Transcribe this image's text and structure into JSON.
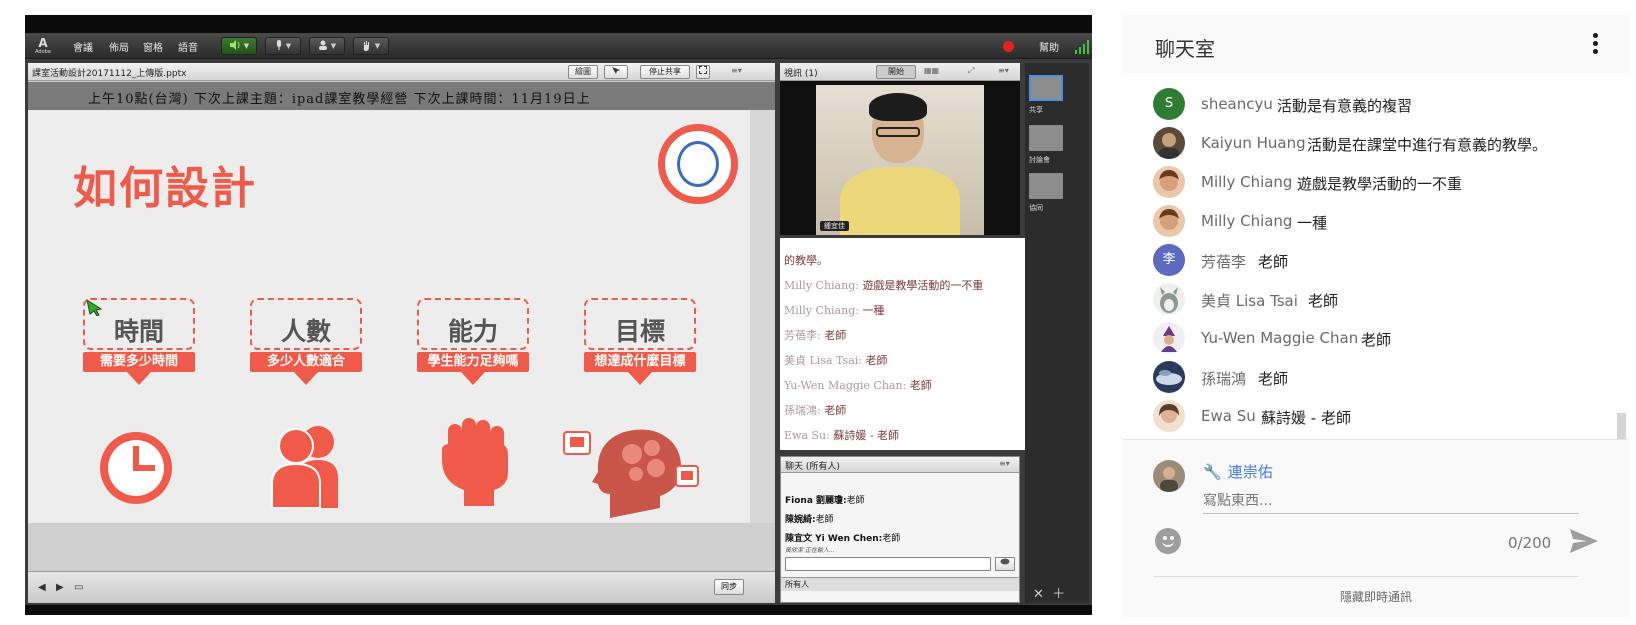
{
  "connect": {
    "logo": "A",
    "logo_sub": "Adobe",
    "menu": [
      "會議",
      "佈局",
      "窗格",
      "語音"
    ],
    "help": "幫助",
    "share_pod": {
      "title": "課室活動設計20171112_上傳版.pptx",
      "buttons": [
        "繪圖",
        "停止共享"
      ],
      "ticker": "上午10點(台灣)  下次上課主題：ipad課室教學經營    下次上課時間：11月19日上",
      "sync_button": "同步"
    },
    "slide": {
      "title": "如何設計",
      "cards": [
        {
          "title": "時間",
          "banner": "需要多少時間",
          "icon": "clock-icon"
        },
        {
          "title": "人數",
          "banner": "多少人數適合",
          "icon": "people-icon"
        },
        {
          "title": "能力",
          "banner": "學生能力足夠嗎",
          "icon": "fist-icon"
        },
        {
          "title": "目標",
          "banner": "想達成什麼目標",
          "icon": "brain-gears-icon"
        }
      ]
    },
    "camera_pod": {
      "title": "視訊 (1)",
      "buttons": [
        "開始"
      ],
      "name_tag": "鍾宜佳"
    },
    "overlay_chat": [
      {
        "name": "",
        "text": "的教學。"
      },
      {
        "name": "Milly Chiang: ",
        "text": "遊戲是教學活動的一不重"
      },
      {
        "name": "Milly Chiang: ",
        "text": "一種"
      },
      {
        "name": "芳蓓李: ",
        "text": "老師"
      },
      {
        "name": "美貞 Lisa Tsai: ",
        "text": "老師"
      },
      {
        "name": "Yu-Wen Maggie Chan: ",
        "text": "老師"
      },
      {
        "name": "孫瑞鴻: ",
        "text": "老師"
      },
      {
        "name": "Ewa Su: ",
        "text": "蘇詩媛 - 老師"
      }
    ],
    "chat_pod": {
      "title": "聊天 (所有人)",
      "lines": [
        {
          "name": "Fiona 劉麗瓊:",
          "text": "老師"
        },
        {
          "name": "陳婉綺:",
          "text": "老師"
        },
        {
          "name": "陳宜文 Yi Wen Chen:",
          "text": "老師"
        }
      ],
      "typing": "黃欣潔 正在輸入...",
      "footer": "所有人"
    },
    "layouts": [
      {
        "label": "共享"
      },
      {
        "label": "討論會"
      },
      {
        "label": "協同"
      }
    ]
  },
  "yt_chat": {
    "title": "聊天室",
    "messages": [
      {
        "author": "sheancyu",
        "text": "活動是有意義的複習",
        "avatar_letter": "S",
        "avatar_color": "#2e7d32"
      },
      {
        "author": "Kaiyun Huang",
        "text": "活動是在課堂中進行有意義的教學。",
        "avatar_letter": "",
        "avatar_color": "#5a4a3a"
      },
      {
        "author": "Milly Chiang",
        "text": "遊戲是教學活動的一不重",
        "avatar_letter": "",
        "avatar_color": "#c89070"
      },
      {
        "author": "Milly Chiang",
        "text": "一種",
        "avatar_letter": "",
        "avatar_color": "#c89070"
      },
      {
        "author": "芳蓓李",
        "text": "老師",
        "avatar_letter": "李",
        "avatar_color": "#5c6bc0"
      },
      {
        "author": "美貞 Lisa Tsai",
        "text": "老師",
        "avatar_letter": "",
        "avatar_color": "#9aa4a0"
      },
      {
        "author": "Yu-Wen Maggie Chan",
        "text": "老師",
        "avatar_letter": "",
        "avatar_color": "#7a4a8a"
      },
      {
        "author": "孫瑞鴻",
        "text": "老師",
        "avatar_letter": "",
        "avatar_color": "#3a4a6a"
      },
      {
        "author": "Ewa Su",
        "text": "蘇詩媛 - 老師",
        "avatar_letter": "",
        "avatar_color": "#b08a6a"
      }
    ],
    "composer": {
      "user_name": "連崇佑",
      "placeholder": "寫點東西...",
      "char_count": "0/200",
      "hide_label": "隱藏即時通訊"
    }
  }
}
